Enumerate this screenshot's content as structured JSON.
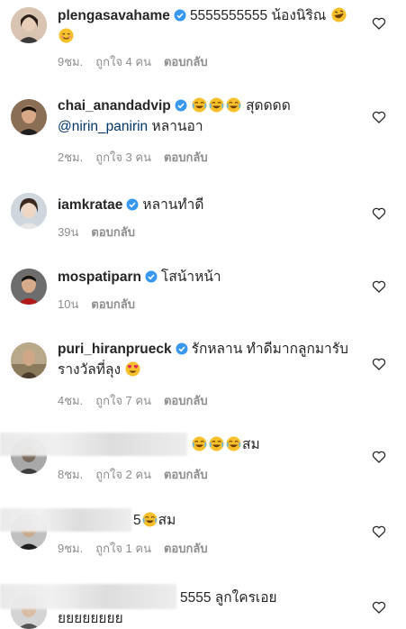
{
  "comments": [
    {
      "username": "plengasavahame",
      "verified": true,
      "text": "5555555555 น้องนิริณ",
      "emojis": [
        "rofl-emoji",
        "smiling-emoji"
      ],
      "time": "9ชม.",
      "likes": "ถูกใจ 4 คน",
      "reply": "ตอบกลับ"
    },
    {
      "username": "chai_anandadvip",
      "verified": true,
      "text_before": "",
      "emojis": [
        "joy-emoji",
        "joy-emoji",
        "joy-emoji"
      ],
      "text": "สุดดดด",
      "mention": "@nirin_panirin",
      "text_after": "หลานอา",
      "time": "2ชม.",
      "likes": "ถูกใจ 3 คน",
      "reply": "ตอบกลับ"
    },
    {
      "username": "iamkratae",
      "verified": true,
      "text": "หลานทำดี",
      "time": "39น",
      "reply": "ตอบกลับ"
    },
    {
      "username": "mospatiparn",
      "verified": true,
      "text": "โสน้าหน้า",
      "time": "10น",
      "reply": "ตอบกลับ"
    },
    {
      "username": "puri_hiranprueck",
      "verified": true,
      "text": "รักหลาน ทำดีมากลูกมารับรางวัลที่ลุง",
      "emojis": [
        "heart-eyes-emoji"
      ],
      "time": "4ชม.",
      "likes": "ถูกใจ 7 คน",
      "reply": "ตอบกลับ"
    },
    {
      "text": "สม",
      "emojis": [
        "joy-emoji",
        "joy-emoji",
        "joy-emoji"
      ],
      "time": "8ชม.",
      "likes": "ถูกใจ 2 คน",
      "reply": "ตอบกลับ"
    },
    {
      "partial": "5",
      "text": "สม",
      "emojis": [
        "joy-emoji"
      ],
      "time": "9ชม.",
      "likes": "ถูกใจ 1 คน",
      "reply": "ตอบกลับ"
    },
    {
      "text": "5555 ลูกใครเอย",
      "text_cont": "ยยยยยยยย"
    }
  ],
  "icons": {
    "like": "heart-outline-icon",
    "verified": "verified-badge-icon"
  },
  "colors": {
    "verified": "#3897f0",
    "meta": "#8e8e8e",
    "mention": "#003569",
    "emoji": "#f7c02b"
  }
}
